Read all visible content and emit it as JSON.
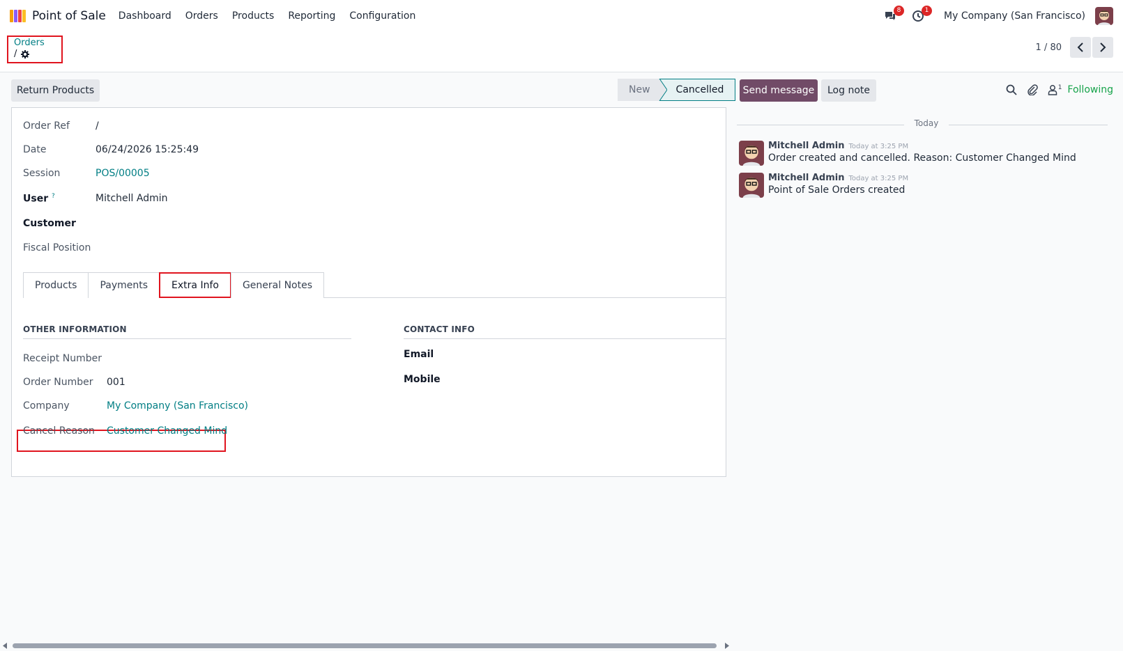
{
  "app": {
    "title": "Point of Sale"
  },
  "menu": [
    "Dashboard",
    "Orders",
    "Products",
    "Reporting",
    "Configuration"
  ],
  "systray": {
    "messages_count": "8",
    "activities_count": "1",
    "company": "My Company (San Francisco)"
  },
  "breadcrumb": {
    "parent": "Orders",
    "current": "/"
  },
  "pager": {
    "value": "1 / 80"
  },
  "actions": {
    "return_products": "Return Products"
  },
  "status": {
    "new": "New",
    "current": "Cancelled"
  },
  "chatter": {
    "send_message": "Send message",
    "log_note": "Log note",
    "followers_count": "1",
    "following": "Following",
    "today": "Today",
    "messages": [
      {
        "author": "Mitchell Admin",
        "time": "Today at 3:25 PM",
        "body": "Order created and cancelled. Reason: Customer Changed Mind"
      },
      {
        "author": "Mitchell Admin",
        "time": "Today at 3:25 PM",
        "body": "Point of Sale Orders created"
      }
    ]
  },
  "form": {
    "order_ref_label": "Order Ref",
    "order_ref": "/",
    "date_label": "Date",
    "date": "06/24/2026 15:25:49",
    "session_label": "Session",
    "session": "POS/00005",
    "user_label": "User",
    "user_help": "?",
    "user": "Mitchell Admin",
    "customer_label": "Customer",
    "fiscal_label": "Fiscal Position"
  },
  "tabs": [
    "Products",
    "Payments",
    "Extra Info",
    "General Notes"
  ],
  "extra": {
    "other_title": "OTHER INFORMATION",
    "receipt_label": "Receipt Number",
    "order_number_label": "Order Number",
    "order_number": "001",
    "company_label": "Company",
    "company": "My Company (San Francisco)",
    "cancel_label": "Cancel Reason",
    "cancel_reason": "Customer Changed Mind",
    "contact_title": "CONTACT INFO",
    "email_label": "Email",
    "mobile_label": "Mobile"
  },
  "colors": {
    "brand": "#714b67",
    "link": "#017e84",
    "highlight": "#e0141e",
    "following": "#16a34a"
  }
}
